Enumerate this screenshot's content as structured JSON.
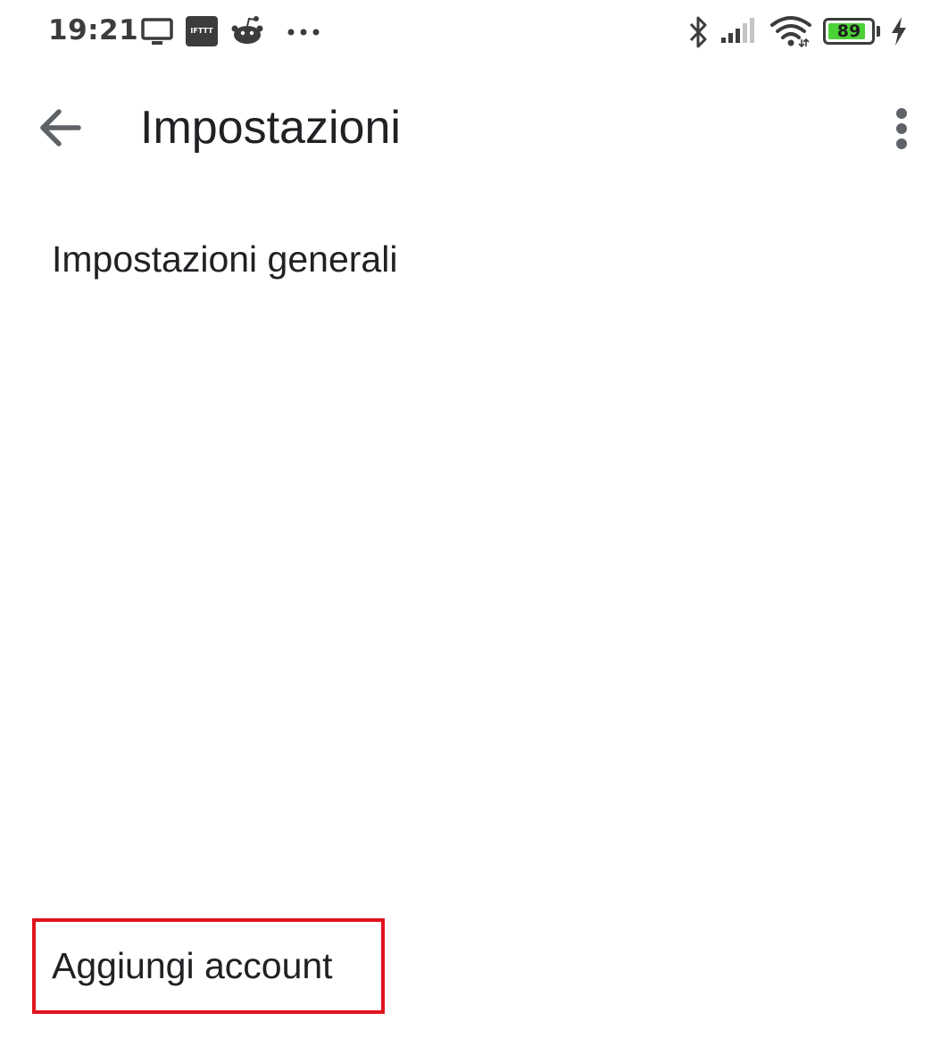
{
  "status_bar": {
    "time": "19:21",
    "notification_icons": [
      "cast-screen-icon",
      "ifttt-icon",
      "reddit-icon",
      "more-notifications-icon"
    ],
    "ifttt_label": "IFTTT",
    "system_icons": [
      "bluetooth-icon",
      "signal-icon",
      "wifi-icon",
      "battery-icon",
      "charging-icon"
    ],
    "battery_level": "89",
    "battery_fraction": 0.89,
    "battery_color": "#4cd137"
  },
  "app_bar": {
    "back_icon": "arrow-back-icon",
    "title": "Impostazioni",
    "overflow_icon": "more-vert-icon"
  },
  "settings": {
    "items": [
      {
        "label": "Impostazioni generali"
      },
      {
        "label": "Aggiungi account",
        "highlighted": true
      }
    ]
  },
  "colors": {
    "text": "#202124",
    "icon": "#5f6368",
    "highlight": "#e0141e"
  }
}
